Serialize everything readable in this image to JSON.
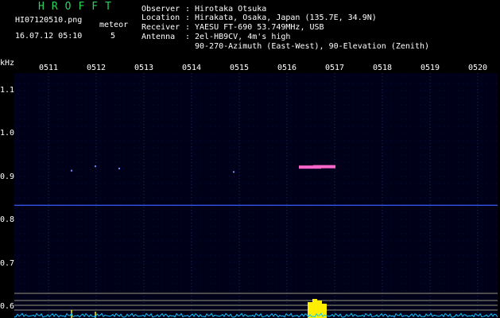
{
  "header": {
    "title": "HROFFT",
    "filename": "HI07120510.png",
    "datetime": "16.07.12 05:10",
    "meteor_label": "meteor",
    "meteor_count": "5"
  },
  "info": {
    "observer_label": "Observer",
    "observer": "Hirotaka Otsuka",
    "location_label": "Location",
    "location": "Hirakata, Osaka, Japan (135.7E, 34.9N)",
    "receiver_label": "Receiver",
    "receiver": "YAESU FT-690 53.749MHz, USB",
    "antenna_label": "Antenna",
    "antenna": "2el-HB9CV, 4m's high",
    "antenna_line2": "90-270-Azimuth (East-West), 90-Elevation (Zenith)"
  },
  "chart_data": {
    "type": "heatmap",
    "xlabel": "",
    "ylabel": "kHz",
    "x_ticks": [
      "0511",
      "0512",
      "0513",
      "0514",
      "0515",
      "0516",
      "0517",
      "0518",
      "0519",
      "0520"
    ],
    "y_ticks": [
      "1.1",
      "1.0",
      "0.9",
      "0.8",
      "0.7",
      "0.6"
    ],
    "ylim": [
      0.575,
      1.14
    ],
    "carrier_line_khz": 0.835,
    "meteor_echoes": [
      {
        "time": "0511.5",
        "khz": 0.915
      },
      {
        "time": "0512.0",
        "khz": 0.925
      },
      {
        "time": "0512.5",
        "khz": 0.92
      },
      {
        "time": "0514.9",
        "khz": 0.912
      },
      {
        "time": "0516.5",
        "khz": 0.925
      },
      {
        "time": "0516.8",
        "khz": 0.926
      }
    ],
    "colors": {
      "background": "#000030",
      "carrier": "#3a5cff",
      "echo": "#ff66cc",
      "level": "#ffee00",
      "noise": "#00c8ff"
    }
  }
}
